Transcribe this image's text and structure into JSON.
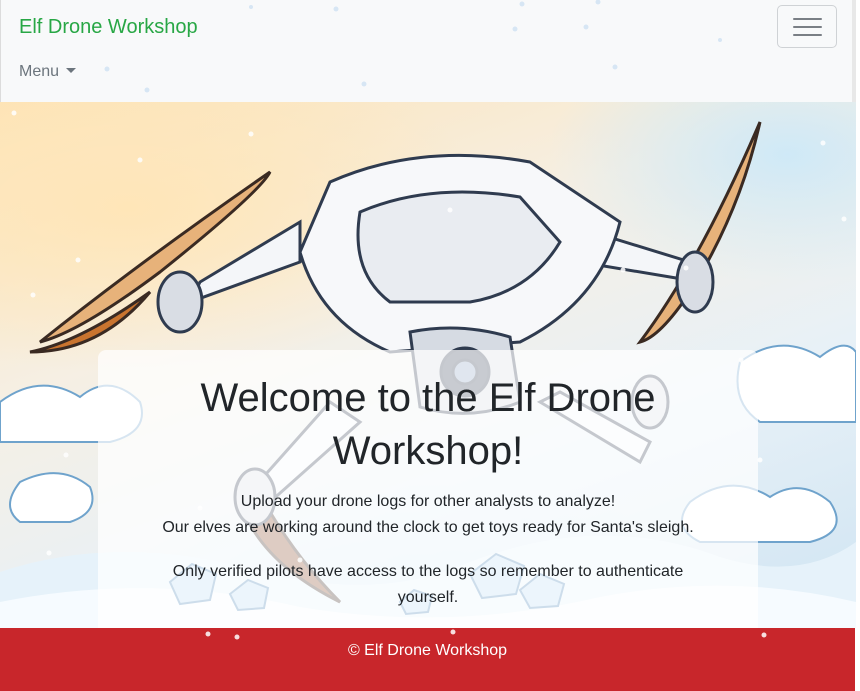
{
  "navbar": {
    "brand": "Elf Drone Workshop",
    "menu_label": "Menu",
    "toggler_icon": "hamburger-icon",
    "brand_color": "#28a745"
  },
  "hero": {
    "title": "Welcome to the Elf Drone Workshop!",
    "line1": "Upload your drone logs for other analysts to analyze!",
    "line2": "Our elves are working around the clock to get toys ready for Santa's sleigh.",
    "line3": "Only verified pilots have access to the logs so remember to authenticate yourself."
  },
  "footer": {
    "text": "© Elf Drone Workshop",
    "background": "#c8262b"
  }
}
